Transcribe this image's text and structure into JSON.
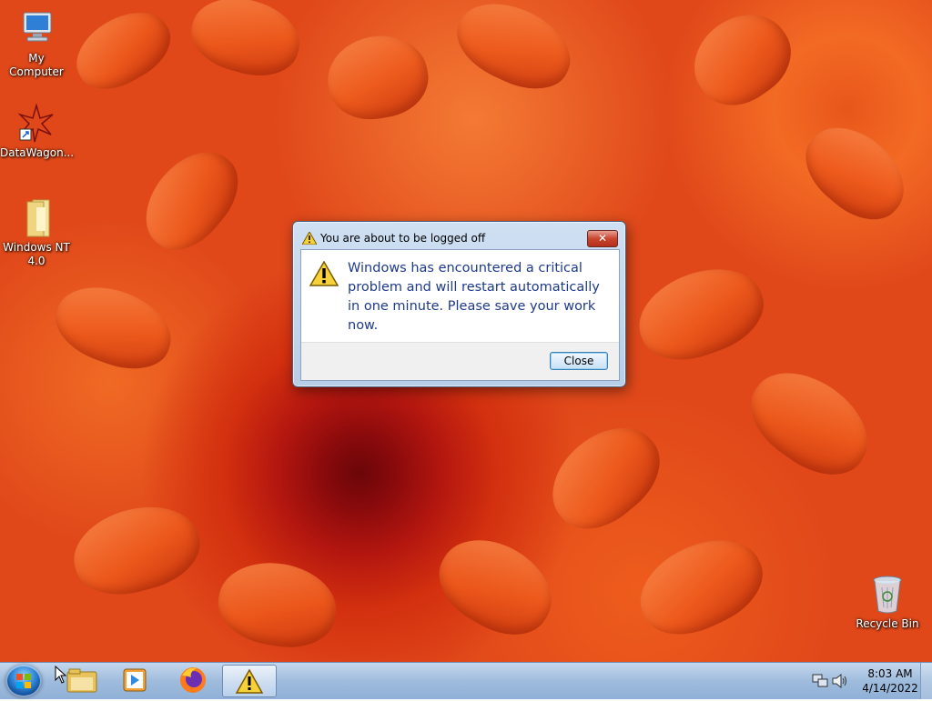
{
  "desktop": {
    "icons": [
      {
        "label": "My Computer",
        "icon": "computer-icon"
      },
      {
        "label": "DataWagon...",
        "icon": "datawagon-icon"
      },
      {
        "label": "Windows NT 4.0",
        "icon": "folder-icon"
      },
      {
        "label": "Recycle Bin",
        "icon": "recycle-bin-icon"
      }
    ]
  },
  "dialog": {
    "title": "You are about to be logged off",
    "close_glyph": "✕",
    "message": "Windows has encountered a critical problem and will restart automatically in one minute. Please save your work now.",
    "close_button_label": "Close",
    "icon": "warning-icon"
  },
  "taskbar": {
    "start_icon": "windows-start-icon",
    "pinned": [
      {
        "name": "file-explorer",
        "icon": "folder-icon"
      },
      {
        "name": "media-player",
        "icon": "media-player-icon"
      },
      {
        "name": "firefox",
        "icon": "firefox-icon"
      },
      {
        "name": "alert-window",
        "icon": "warning-icon"
      }
    ],
    "tray": {
      "time": "8:03 AM",
      "date": "4/14/2022",
      "icons": [
        "network-icon",
        "volume-icon"
      ]
    }
  }
}
